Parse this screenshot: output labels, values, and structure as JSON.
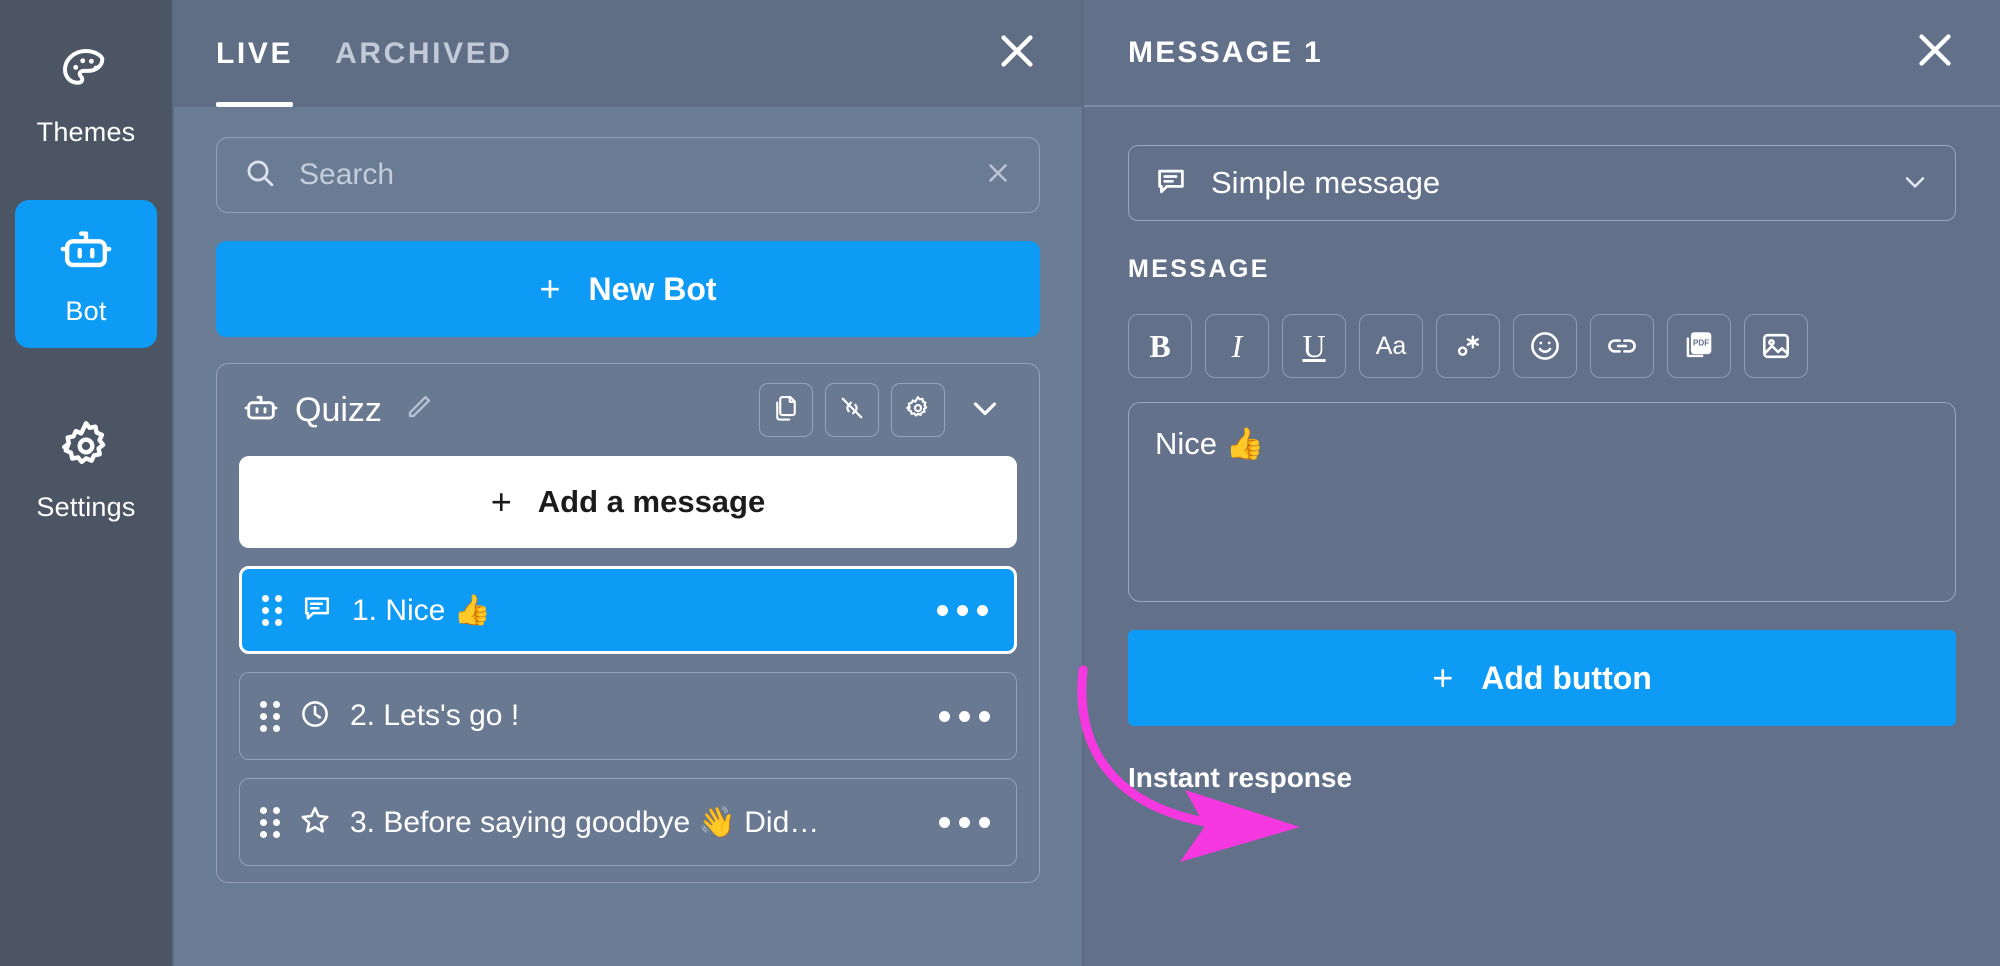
{
  "sidebar": {
    "items": [
      {
        "label": "Themes",
        "icon": "palette-icon",
        "active": false
      },
      {
        "label": "Bot",
        "icon": "robot-icon",
        "active": true
      },
      {
        "label": "Settings",
        "icon": "gear-icon",
        "active": false
      }
    ]
  },
  "middle": {
    "tabs": [
      {
        "label": "LIVE",
        "active": true
      },
      {
        "label": "ARCHIVED",
        "active": false
      }
    ],
    "close_icon": "close-icon",
    "search": {
      "placeholder": "Search",
      "value": "",
      "icon": "search-icon",
      "clear_icon": "close-icon"
    },
    "new_bot": {
      "label": "New Bot",
      "plus": "+"
    },
    "bot": {
      "name": "Quizz",
      "icon": "robot-icon",
      "edit_icon": "pencil-icon",
      "actions": [
        {
          "name": "duplicate-icon"
        },
        {
          "name": "link-off-icon"
        },
        {
          "name": "gear-icon"
        }
      ],
      "collapse_icon": "chevron-down-icon",
      "add_message": {
        "label": "Add a message",
        "plus": "+"
      },
      "messages": [
        {
          "label": "1. Nice 👍",
          "icon": "message-icon",
          "selected": true,
          "menu": "more-icon"
        },
        {
          "label": "2. Lets's go !",
          "icon": "clock-icon",
          "selected": false,
          "menu": "more-icon"
        },
        {
          "label": "3. Before saying goodbye 👋 Did…",
          "icon": "star-icon",
          "selected": false,
          "menu": "more-icon"
        }
      ]
    }
  },
  "right": {
    "title": "MESSAGE 1",
    "close_icon": "close-icon",
    "type_select": {
      "value": "Simple message",
      "icon": "message-icon",
      "chevron": "chevron-down-icon"
    },
    "message_label": "MESSAGE",
    "toolbar": [
      {
        "name": "bold-icon",
        "glyph": "B"
      },
      {
        "name": "italic-icon",
        "glyph": "I"
      },
      {
        "name": "underline-icon",
        "glyph": "U"
      },
      {
        "name": "font-size-icon",
        "glyph": "Aa"
      },
      {
        "name": "variable-icon",
        "glyph": "∘*"
      },
      {
        "name": "emoji-icon",
        "glyph": "☺"
      },
      {
        "name": "link-icon",
        "glyph": "🔗"
      },
      {
        "name": "pdf-icon",
        "glyph": "PDF"
      },
      {
        "name": "image-icon",
        "glyph": "🖼"
      }
    ],
    "editor": {
      "value": "Nice 👍",
      "placeholder": ""
    },
    "add_button": {
      "label": "Add button",
      "plus": "+"
    },
    "instant_response": "Instant response"
  },
  "annotation": {
    "arrow_color": "#f538e0"
  },
  "colors": {
    "accent_blue": "#0d9bf5",
    "rail_bg": "#4b5564",
    "mid_bg": "#6a7b94",
    "mid_head_bg": "#5f6d85",
    "right_bg": "#62708a",
    "text_white": "#ffffff",
    "text_muted": "#c2cad8"
  }
}
